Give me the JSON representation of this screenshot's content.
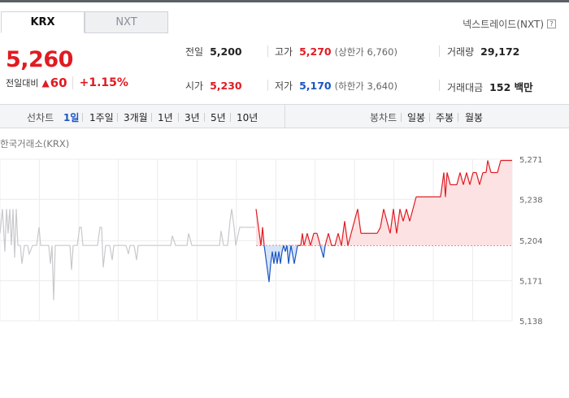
{
  "tabs": [
    {
      "label": "KRX",
      "active": true
    },
    {
      "label": "NXT",
      "active": false
    }
  ],
  "nxt_link": {
    "label": "넥스트레이드(NXT)",
    "help_icon": "?"
  },
  "price": {
    "current": "5,260",
    "change_label": "전일대비",
    "change_icon": "up-triangle-icon",
    "change_value": "60",
    "change_pct": "+1.15%"
  },
  "stats": {
    "prev_close": {
      "label": "전일",
      "value": "5,200"
    },
    "open": {
      "label": "시가",
      "value": "5,230"
    },
    "high": {
      "label": "고가",
      "value": "5,270",
      "sub": "(상한가 6,760)"
    },
    "low": {
      "label": "저가",
      "value": "5,170",
      "sub": "(하한가 3,640)"
    },
    "volume": {
      "label": "거래량",
      "value": "29,172"
    },
    "trade_value": {
      "label": "거래대금",
      "value": "152 백만"
    }
  },
  "line_chart_periods": {
    "label": "선차트",
    "items": [
      "1일",
      "1주일",
      "3개월",
      "1년",
      "3년",
      "5년",
      "10년"
    ],
    "active": "1일"
  },
  "candle_chart_periods": {
    "label": "봉차트",
    "items": [
      "일봉",
      "주봉",
      "월봉"
    ]
  },
  "exchange_label": "한국거래소(KRX)",
  "colors": {
    "up": "#e01b22",
    "down": "#1a55c5",
    "prev_day": "#c7c9cc",
    "up_fill": "#fde2e3",
    "down_fill": "#d6e4f7"
  },
  "chart_data": {
    "type": "line",
    "y_ticks": [
      "5,271",
      "5,238",
      "5,204",
      "5,171",
      "5,138"
    ],
    "ylim": [
      5138,
      5271
    ],
    "baseline": 5200,
    "grid": true,
    "series": [
      {
        "name": "",
        "segment": "previous-day",
        "points": [
          [
            0,
            5210
          ],
          [
            3,
            5230
          ],
          [
            6,
            5195
          ],
          [
            8,
            5230
          ],
          [
            10,
            5210
          ],
          [
            12,
            5230
          ],
          [
            14,
            5200
          ],
          [
            16,
            5230
          ],
          [
            18,
            5190
          ],
          [
            20,
            5230
          ],
          [
            22,
            5200
          ],
          [
            25,
            5200
          ],
          [
            27,
            5185
          ],
          [
            30,
            5200
          ],
          [
            34,
            5200
          ],
          [
            36,
            5193
          ],
          [
            40,
            5200
          ],
          [
            45,
            5200
          ],
          [
            48,
            5215
          ],
          [
            50,
            5200
          ],
          [
            55,
            5200
          ],
          [
            60,
            5200
          ],
          [
            62,
            5185
          ],
          [
            64,
            5200
          ],
          [
            66,
            5155
          ],
          [
            68,
            5200
          ],
          [
            75,
            5200
          ],
          [
            80,
            5200
          ],
          [
            86,
            5200
          ],
          [
            88,
            5180
          ],
          [
            90,
            5200
          ],
          [
            95,
            5200
          ],
          [
            98,
            5215
          ],
          [
            100,
            5215
          ],
          [
            102,
            5200
          ],
          [
            106,
            5200
          ],
          [
            110,
            5200
          ],
          [
            115,
            5200
          ],
          [
            120,
            5200
          ],
          [
            123,
            5215
          ],
          [
            125,
            5215
          ],
          [
            127,
            5182
          ],
          [
            130,
            5200
          ],
          [
            135,
            5200
          ],
          [
            138,
            5188
          ],
          [
            140,
            5200
          ],
          [
            145,
            5200
          ],
          [
            150,
            5200
          ],
          [
            155,
            5200
          ],
          [
            158,
            5193
          ],
          [
            160,
            5200
          ],
          [
            165,
            5200
          ],
          [
            168,
            5188
          ],
          [
            170,
            5200
          ],
          [
            175,
            5200
          ],
          [
            180,
            5200
          ],
          [
            185,
            5200
          ],
          [
            190,
            5200
          ],
          [
            195,
            5200
          ],
          [
            200,
            5200
          ],
          [
            205,
            5200
          ],
          [
            210,
            5200
          ],
          [
            212,
            5208
          ],
          [
            216,
            5200
          ],
          [
            220,
            5200
          ],
          [
            225,
            5200
          ],
          [
            230,
            5200
          ],
          [
            232,
            5210
          ],
          [
            236,
            5200
          ],
          [
            240,
            5200
          ],
          [
            245,
            5200
          ],
          [
            250,
            5200
          ],
          [
            255,
            5200
          ],
          [
            260,
            5200
          ],
          [
            265,
            5200
          ],
          [
            270,
            5200
          ],
          [
            272,
            5212
          ],
          [
            275,
            5200
          ],
          [
            280,
            5200
          ],
          [
            283,
            5220
          ],
          [
            285,
            5230
          ],
          [
            288,
            5215
          ],
          [
            290,
            5200
          ],
          [
            295,
            5215
          ],
          [
            300,
            5215
          ],
          [
            305,
            5215
          ],
          [
            310,
            5215
          ],
          [
            314,
            5215
          ]
        ]
      },
      {
        "name": "",
        "segment": "today",
        "points": [
          [
            315,
            5230
          ],
          [
            317,
            5220
          ],
          [
            319,
            5210
          ],
          [
            321,
            5200
          ],
          [
            323,
            5215
          ],
          [
            325,
            5200
          ],
          [
            327,
            5190
          ],
          [
            329,
            5180
          ],
          [
            331,
            5170
          ],
          [
            333,
            5185
          ],
          [
            335,
            5195
          ],
          [
            337,
            5185
          ],
          [
            339,
            5195
          ],
          [
            341,
            5185
          ],
          [
            343,
            5195
          ],
          [
            345,
            5185
          ],
          [
            347,
            5195
          ],
          [
            349,
            5200
          ],
          [
            351,
            5195
          ],
          [
            353,
            5200
          ],
          [
            355,
            5185
          ],
          [
            358,
            5200
          ],
          [
            362,
            5185
          ],
          [
            366,
            5200
          ],
          [
            370,
            5200
          ],
          [
            372,
            5210
          ],
          [
            374,
            5200
          ],
          [
            378,
            5210
          ],
          [
            382,
            5200
          ],
          [
            386,
            5210
          ],
          [
            390,
            5210
          ],
          [
            394,
            5200
          ],
          [
            396,
            5195
          ],
          [
            398,
            5190
          ],
          [
            400,
            5200
          ],
          [
            404,
            5210
          ],
          [
            408,
            5200
          ],
          [
            412,
            5200
          ],
          [
            416,
            5210
          ],
          [
            420,
            5200
          ],
          [
            424,
            5220
          ],
          [
            428,
            5200
          ],
          [
            432,
            5210
          ],
          [
            436,
            5220
          ],
          [
            440,
            5230
          ],
          [
            444,
            5210
          ],
          [
            448,
            5210
          ],
          [
            452,
            5210
          ],
          [
            456,
            5210
          ],
          [
            460,
            5210
          ],
          [
            464,
            5210
          ],
          [
            468,
            5215
          ],
          [
            472,
            5230
          ],
          [
            476,
            5220
          ],
          [
            480,
            5210
          ],
          [
            484,
            5230
          ],
          [
            488,
            5210
          ],
          [
            492,
            5230
          ],
          [
            496,
            5220
          ],
          [
            500,
            5230
          ],
          [
            504,
            5220
          ],
          [
            508,
            5230
          ],
          [
            512,
            5240
          ],
          [
            518,
            5240
          ],
          [
            524,
            5240
          ],
          [
            530,
            5240
          ],
          [
            536,
            5240
          ],
          [
            542,
            5240
          ],
          [
            546,
            5260
          ],
          [
            548,
            5240
          ],
          [
            550,
            5260
          ],
          [
            554,
            5250
          ],
          [
            558,
            5250
          ],
          [
            562,
            5250
          ],
          [
            566,
            5260
          ],
          [
            570,
            5250
          ],
          [
            574,
            5260
          ],
          [
            578,
            5250
          ],
          [
            582,
            5260
          ],
          [
            586,
            5260
          ],
          [
            590,
            5250
          ],
          [
            594,
            5260
          ],
          [
            598,
            5260
          ],
          [
            600,
            5270
          ],
          [
            604,
            5260
          ],
          [
            608,
            5260
          ],
          [
            612,
            5260
          ],
          [
            616,
            5270
          ],
          [
            620,
            5270
          ],
          [
            624,
            5270
          ],
          [
            628,
            5270
          ],
          [
            630,
            5270
          ]
        ]
      }
    ]
  }
}
